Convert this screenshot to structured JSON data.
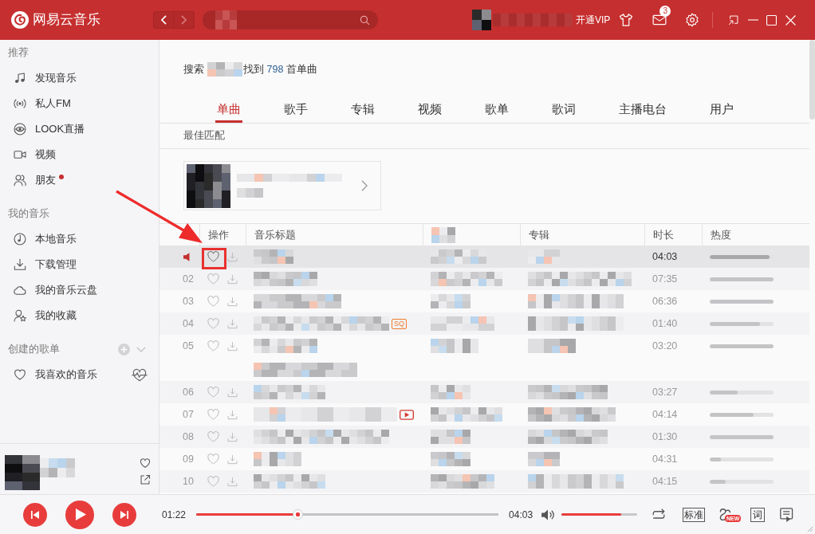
{
  "window": {
    "app_name": "网易云音乐",
    "back_enabled": true,
    "forward_enabled": false,
    "vip_label": "开通VIP",
    "mail_count": "3"
  },
  "sidebar": {
    "sections": [
      {
        "title": "推荐",
        "kind": "fixed",
        "items": [
          {
            "label": "发现音乐",
            "kind": "nav",
            "selected": false,
            "dot": false
          },
          {
            "label": "私人FM",
            "kind": "nav",
            "selected": false,
            "dot": false
          },
          {
            "label": "LOOK直播",
            "kind": "nav",
            "selected": false,
            "dot": false
          },
          {
            "label": "视频",
            "kind": "nav",
            "selected": false,
            "dot": false
          },
          {
            "label": "朋友",
            "kind": "nav",
            "selected": false,
            "dot": true
          }
        ]
      },
      {
        "title": "我的音乐",
        "kind": "fixed",
        "items": [
          {
            "label": "本地音乐",
            "kind": "nav",
            "selected": false,
            "dot": false
          },
          {
            "label": "下载管理",
            "kind": "nav",
            "selected": false,
            "dot": false
          },
          {
            "label": "我的音乐云盘",
            "kind": "nav",
            "selected": false,
            "dot": false
          },
          {
            "label": "我的收藏",
            "kind": "nav",
            "selected": false,
            "dot": false
          }
        ]
      },
      {
        "title": "创建的歌单",
        "kind": "created",
        "items": [
          {
            "label": "我喜欢的音乐",
            "kind": "liked_playlist",
            "selected": false,
            "dot": false
          }
        ]
      }
    ],
    "now_playing": {
      "liked": false
    }
  },
  "search": {
    "prefix": "搜索",
    "middle": "找到",
    "count": "798",
    "suffix": "首单曲"
  },
  "tabs": [
    {
      "label": "单曲",
      "selected": true
    },
    {
      "label": "歌手",
      "selected": false
    },
    {
      "label": "专辑",
      "selected": false
    },
    {
      "label": "视频",
      "selected": false
    },
    {
      "label": "歌单",
      "selected": false
    },
    {
      "label": "歌词",
      "selected": false
    },
    {
      "label": "主播电台",
      "selected": false
    },
    {
      "label": "用户",
      "selected": false
    }
  ],
  "best_match": {
    "label": "最佳匹配"
  },
  "table": {
    "columns": [
      {
        "label": "操作",
        "pixelated": false
      },
      {
        "label": "音乐标题",
        "pixelated": false
      },
      {
        "pixelated": true
      },
      {
        "label": "专辑",
        "pixelated": false
      },
      {
        "label": "时长",
        "pixelated": false
      },
      {
        "label": "热度",
        "pixelated": false
      }
    ],
    "rows": [
      {
        "selected": true,
        "playing": true,
        "liked": false,
        "mv": false,
        "two_line_title": false,
        "annotated": true,
        "duration": "04:03",
        "level": 0.94
      },
      {
        "selected": false,
        "playing": false,
        "index": "02",
        "liked": false,
        "mv": false,
        "two_line_title": false,
        "annotated": false,
        "duration": "07:35",
        "level": 1
      },
      {
        "selected": false,
        "playing": false,
        "index": "03",
        "liked": false,
        "mv": false,
        "two_line_title": false,
        "annotated": false,
        "duration": "06:36",
        "level": 1
      },
      {
        "selected": false,
        "playing": false,
        "index": "04",
        "liked": false,
        "badge": "SQ",
        "mv": false,
        "two_line_title": false,
        "annotated": false,
        "duration": "01:40",
        "level": 0.79
      },
      {
        "selected": false,
        "playing": false,
        "index": "05",
        "liked": false,
        "mv": false,
        "two_line_title": true,
        "annotated": false,
        "duration": "03:20",
        "level": 1
      },
      {
        "selected": false,
        "playing": false,
        "index": "06",
        "liked": false,
        "mv": false,
        "two_line_title": false,
        "annotated": false,
        "duration": "03:27",
        "level": 0.44
      },
      {
        "selected": false,
        "playing": false,
        "index": "07",
        "liked": false,
        "mv": true,
        "two_line_title": false,
        "annotated": false,
        "duration": "04:14",
        "level": 0.69
      },
      {
        "selected": false,
        "playing": false,
        "index": "08",
        "liked": false,
        "mv": false,
        "two_line_title": false,
        "annotated": false,
        "duration": "01:30",
        "level": 1
      },
      {
        "selected": false,
        "playing": false,
        "index": "09",
        "liked": false,
        "mv": false,
        "two_line_title": false,
        "annotated": false,
        "duration": "04:31",
        "level": 0.17
      },
      {
        "selected": false,
        "playing": false,
        "index": "10",
        "liked": false,
        "mv": false,
        "two_line_title": false,
        "annotated": false,
        "duration": "04:15",
        "level": 0.25
      }
    ]
  },
  "player": {
    "paused": true,
    "current_time": "01:22",
    "total_time": "04:03",
    "level": 0.335,
    "volume": {
      "level": 0.79
    },
    "quality": "标准",
    "effect_badge": "NEW",
    "lyrics": "词"
  }
}
